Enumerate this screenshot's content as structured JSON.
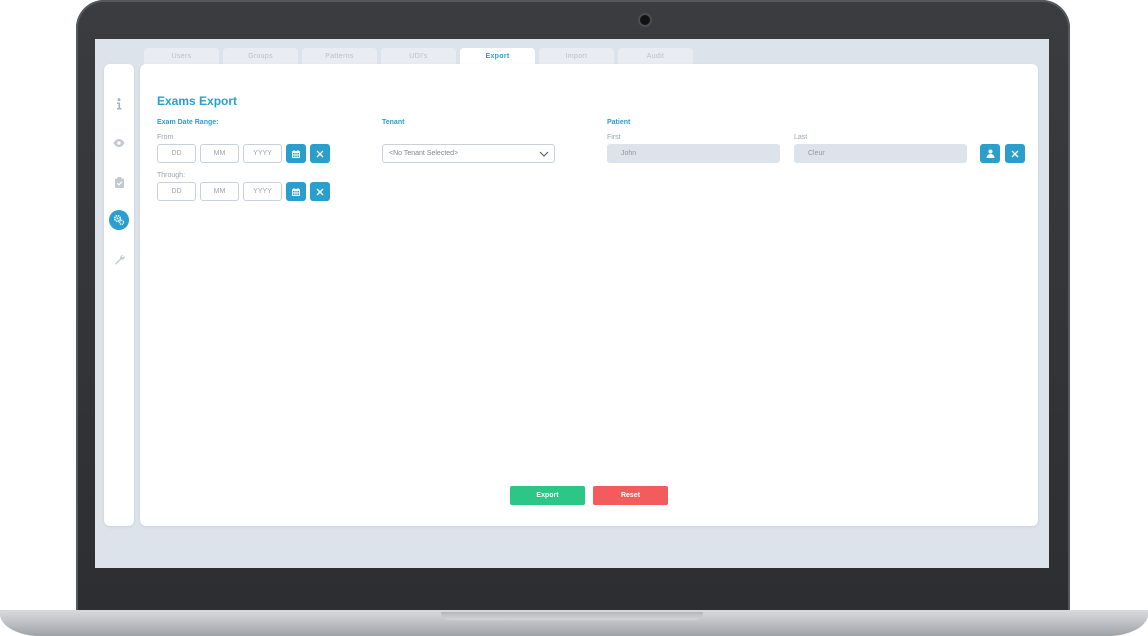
{
  "colors": {
    "accent": "#2a9fcc",
    "export": "#2cc787",
    "reset": "#f25c5c"
  },
  "tabs": [
    {
      "label": "Users"
    },
    {
      "label": "Groups"
    },
    {
      "label": "Patterns"
    },
    {
      "label": "UDI's"
    },
    {
      "label": "Export",
      "active": true
    },
    {
      "label": "Import"
    },
    {
      "label": "Audit"
    }
  ],
  "sidebar": {
    "items": [
      {
        "icon": "info-icon"
      },
      {
        "icon": "eye-icon"
      },
      {
        "icon": "clipboard-icon"
      },
      {
        "icon": "gears-icon",
        "active": true
      },
      {
        "icon": "wrench-icon"
      }
    ]
  },
  "page": {
    "title": "Exams Export"
  },
  "date_range": {
    "label": "Exam Date Range:",
    "from_label": "From",
    "through_label": "Through:",
    "day_placeholder": "DD",
    "month_placeholder": "MM",
    "year_placeholder": "YYYY"
  },
  "tenant": {
    "label": "Tenant",
    "selected": "<No Tenant Selected>"
  },
  "patient": {
    "label": "Patient",
    "first_label": "First",
    "first_value": "John",
    "last_label": "Last",
    "last_value": "Cleur"
  },
  "actions": {
    "export": "Export",
    "reset": "Reset"
  }
}
